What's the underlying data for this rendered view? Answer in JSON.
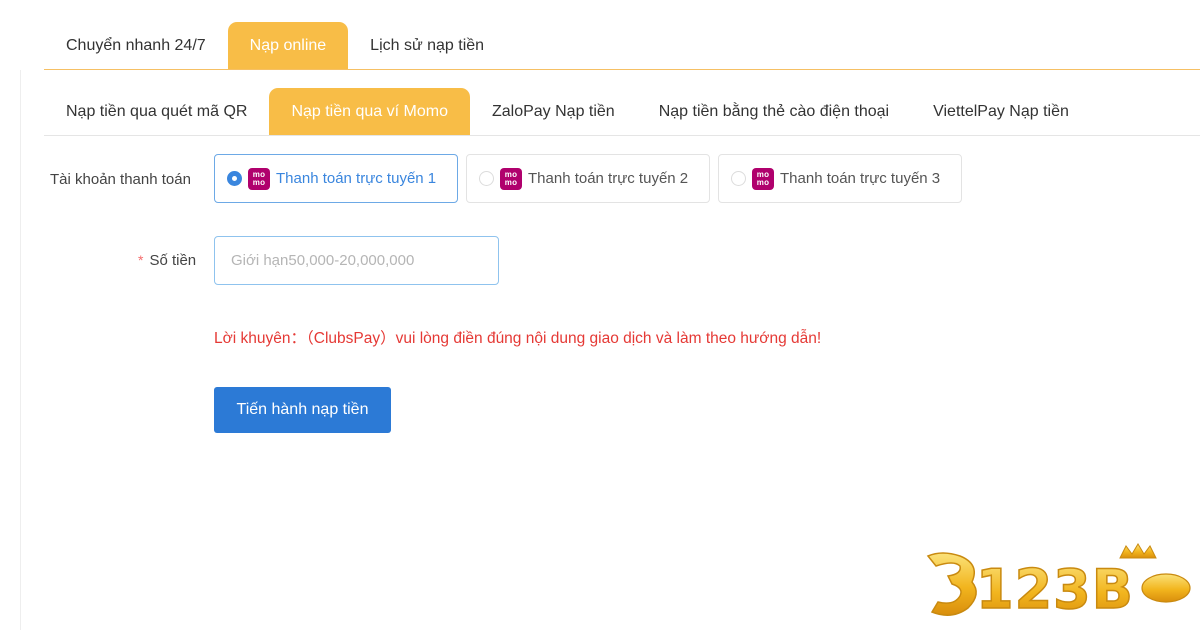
{
  "main_tabs": [
    {
      "label": "Chuyển nhanh 24/7"
    },
    {
      "label": "Nạp online"
    },
    {
      "label": "Lịch sử nạp tiền"
    }
  ],
  "sub_tabs": [
    {
      "label": "Nạp tiền qua quét mã QR"
    },
    {
      "label": "Nạp tiền qua ví Momo"
    },
    {
      "label": "ZaloPay Nạp tiền"
    },
    {
      "label": "Nạp tiền bằng thẻ cào điện thoại"
    },
    {
      "label": "ViettelPay Nạp tiền"
    }
  ],
  "form": {
    "account_label": "Tài khoản thanh toán",
    "amount_label": "Số tiền",
    "required_mark": "*",
    "amount_placeholder": "Giới hạn50,000-20,000,000",
    "amount_value": "",
    "payment_options": [
      {
        "label": "Thanh toán trực tuyến 1",
        "selected": true,
        "icon": "momo-icon"
      },
      {
        "label": "Thanh toán trực tuyến 2",
        "selected": false,
        "icon": "momo-icon"
      },
      {
        "label": "Thanh toán trực tuyến 3",
        "selected": false,
        "icon": "momo-icon"
      }
    ],
    "tip": "Lời khuyên：（ClubsPay）vui lòng điền đúng nội dung giao dịch và làm theo hướng dẫn!",
    "submit_label": "Tiến hành nạp tiền"
  },
  "momo_text": {
    "top": "mo",
    "bottom": "mo"
  },
  "watermark": {
    "text": "123B"
  },
  "colors": {
    "tab_active": "#f8bd47",
    "primary": "#2c7ad6",
    "warning_text": "#e53935",
    "momo_brand": "#b0006d"
  }
}
